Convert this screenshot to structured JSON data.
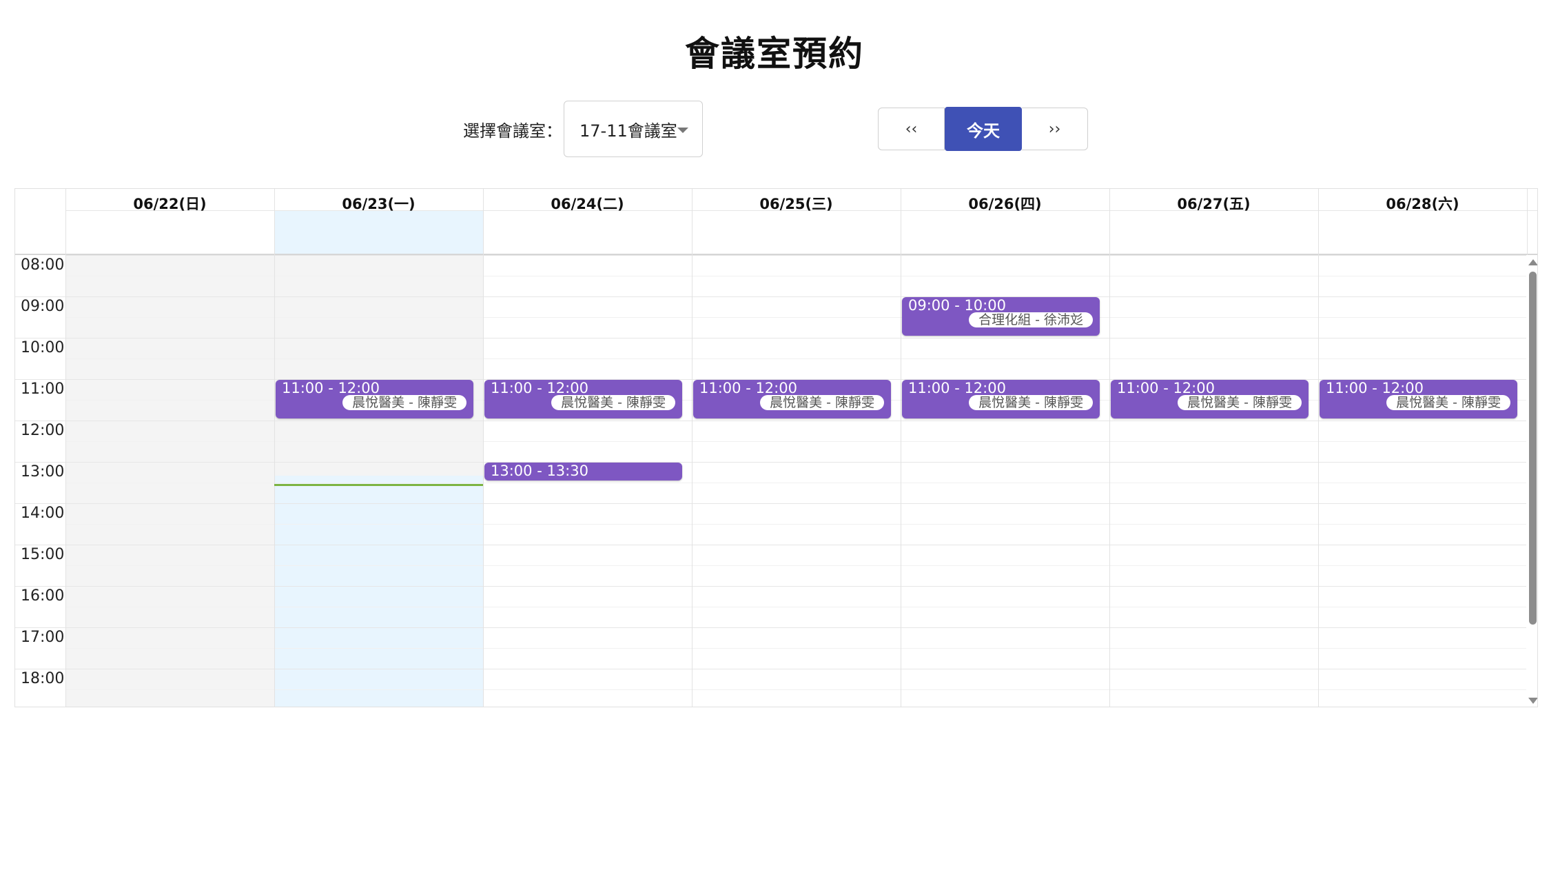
{
  "title": "會議室預約",
  "room_selector": {
    "label": "選擇會議室：",
    "selected": "17-11會議室"
  },
  "nav": {
    "prev_label": "‹‹",
    "today_label": "今天",
    "next_label": "››"
  },
  "colors": {
    "accent": "#3f51b5",
    "event": "#7e57c2",
    "today_column": "#e8f5fe",
    "past_column": "#f4f4f4",
    "now_indicator": "#7cb342"
  },
  "days": [
    {
      "label": "06/22(日)",
      "state": "past"
    },
    {
      "label": "06/23(一)",
      "state": "today"
    },
    {
      "label": "06/24(二)",
      "state": "future"
    },
    {
      "label": "06/25(三)",
      "state": "future"
    },
    {
      "label": "06/26(四)",
      "state": "future"
    },
    {
      "label": "06/27(五)",
      "state": "future"
    },
    {
      "label": "06/28(六)",
      "state": "future"
    }
  ],
  "hours": [
    "08:00",
    "09:00",
    "10:00",
    "11:00",
    "12:00",
    "13:00",
    "14:00",
    "15:00",
    "16:00",
    "17:00",
    "18:00"
  ],
  "events": [
    {
      "day": 4,
      "start": 9.0,
      "end": 10.0,
      "time": "09:00 - 10:00",
      "desc": "合理化組 - 徐沛彣"
    },
    {
      "day": 1,
      "start": 11.0,
      "end": 12.0,
      "time": "11:00 - 12:00",
      "desc": "晨悅醫美 - 陳靜雯"
    },
    {
      "day": 2,
      "start": 11.0,
      "end": 12.0,
      "time": "11:00 - 12:00",
      "desc": "晨悅醫美 - 陳靜雯"
    },
    {
      "day": 3,
      "start": 11.0,
      "end": 12.0,
      "time": "11:00 - 12:00",
      "desc": "晨悅醫美 - 陳靜雯"
    },
    {
      "day": 4,
      "start": 11.0,
      "end": 12.0,
      "time": "11:00 - 12:00",
      "desc": "晨悅醫美 - 陳靜雯"
    },
    {
      "day": 5,
      "start": 11.0,
      "end": 12.0,
      "time": "11:00 - 12:00",
      "desc": "晨悅醫美 - 陳靜雯"
    },
    {
      "day": 6,
      "start": 11.0,
      "end": 12.0,
      "time": "11:00 - 12:00",
      "desc": "晨悅醫美 - 陳靜雯"
    },
    {
      "day": 2,
      "start": 13.0,
      "end": 13.5,
      "time": "13:00 - 13:30",
      "desc": ""
    }
  ],
  "now_indicator": {
    "day": 1,
    "time": 13.33
  }
}
